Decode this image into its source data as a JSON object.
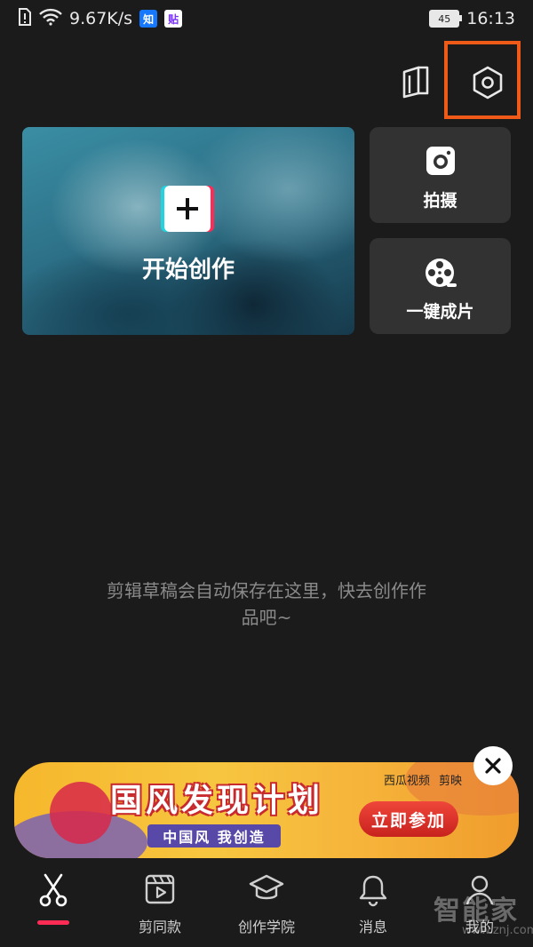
{
  "status_bar": {
    "speed": "9.67K/s",
    "badge_zhi": "知",
    "badge_tie": "贴",
    "battery": "45",
    "time": "16:13"
  },
  "top_bar": {
    "tutorial_icon": "book-icon",
    "settings_icon": "settings-hexagon-icon",
    "highlight_color": "#f05a18"
  },
  "create_card": {
    "label": "开始创作",
    "icon": "plus-icon"
  },
  "side_cards": [
    {
      "label": "拍摄",
      "icon": "camera-icon"
    },
    {
      "label": "一键成片",
      "icon": "film-reel-icon"
    }
  ],
  "empty_state": {
    "line1": "剪辑草稿会自动保存在这里，快去创作作",
    "line2": "品吧~"
  },
  "banner": {
    "title": "国风发现计划",
    "subtitle": "中国风 我创造",
    "brand1": "西瓜视频",
    "brand2": "剪映",
    "cta": "立即参加",
    "close_icon": "close-icon"
  },
  "bottom_nav": [
    {
      "label": "",
      "icon": "scissors-icon",
      "active": true
    },
    {
      "label": "剪同款",
      "icon": "template-video-icon"
    },
    {
      "label": "创作学院",
      "icon": "graduation-cap-icon"
    },
    {
      "label": "消息",
      "icon": "bell-icon"
    },
    {
      "label": "我的",
      "icon": "user-icon"
    }
  ],
  "accent_color": "#fe2c55",
  "watermark": {
    "main": "智能家",
    "sub": "www.znj.com"
  }
}
